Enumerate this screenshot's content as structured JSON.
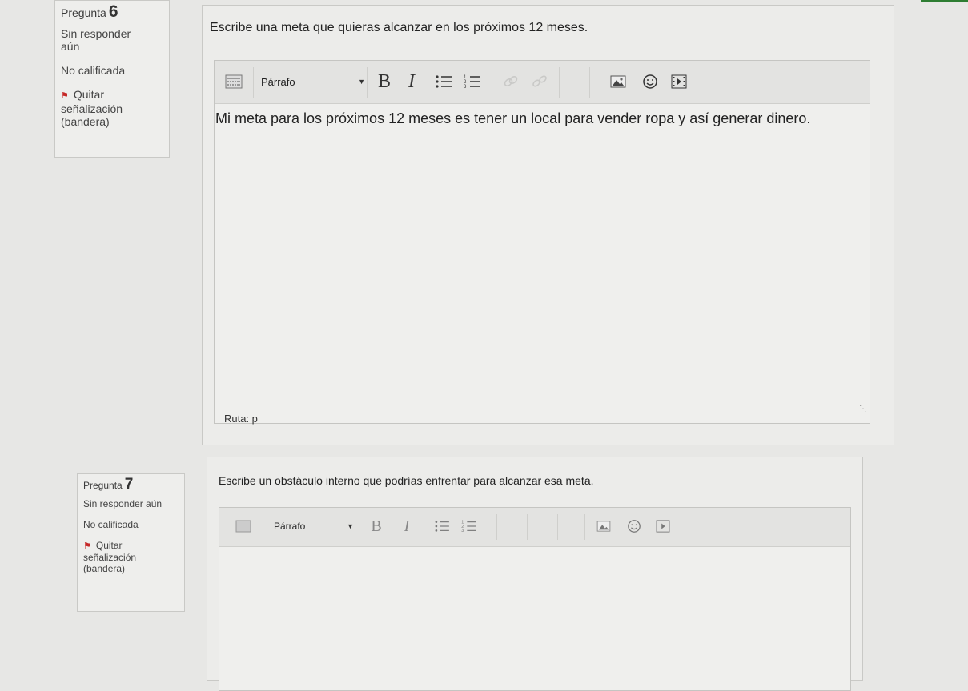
{
  "q6": {
    "label": "Pregunta",
    "number": "6",
    "state": "Sin responder aún",
    "grade": "No calificada",
    "flag": "Quitar señalización (bandera)",
    "text": "Escribe una meta que quieras alcanzar en los próximos 12 meses.",
    "editor": {
      "format": "Párrafo",
      "bold": "B",
      "italic": "I",
      "answer": "Mi meta para los próximos 12 meses es tener un local para vender ropa y así generar dinero.",
      "path": "Ruta: p"
    }
  },
  "q7": {
    "label": "Pregunta",
    "number": "7",
    "state": "Sin responder aún",
    "grade": "No calificada",
    "flag": "Quitar señalización (bandera)",
    "text": "Escribe un obstáculo interno que podrías enfrentar para alcanzar esa meta.",
    "editor": {
      "format": "Párrafo",
      "bold": "B",
      "italic": "I",
      "answer": ""
    }
  },
  "icons": [
    "toggle-toolbar-icon",
    "bullet-list-icon",
    "numbered-list-icon",
    "link-icon",
    "unlink-icon",
    "image-icon",
    "emoji-icon",
    "media-icon",
    "flag-icon",
    "dropdown-caret-icon",
    "resize-handle-icon"
  ],
  "colors": {
    "flag": "#c62828",
    "accent": "#2e7d32"
  }
}
